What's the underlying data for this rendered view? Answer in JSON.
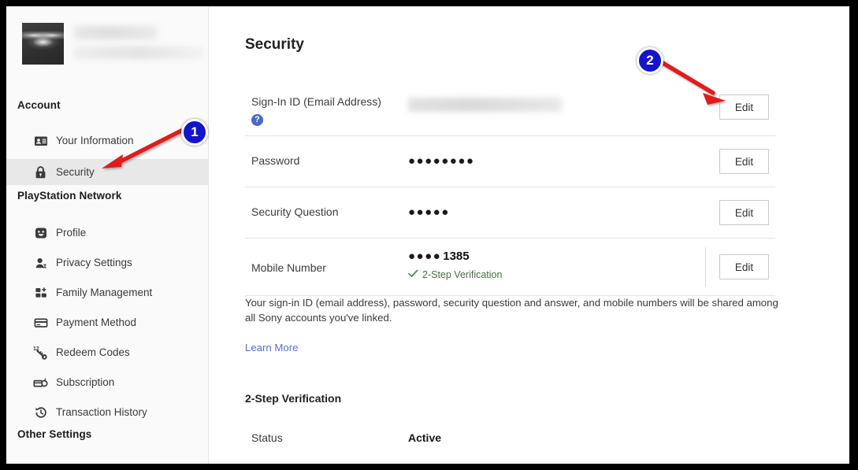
{
  "sidebar": {
    "profile": {
      "avatar_icon": "moth-avatar-image",
      "name_redacted": true,
      "email_redacted": true
    },
    "groups": [
      {
        "title": "Account"
      },
      {
        "title": "PlayStation Network"
      },
      {
        "title": "Other Settings"
      }
    ],
    "account_items": [
      {
        "label": "Your Information",
        "icon": "id-card-icon",
        "active": false
      },
      {
        "label": "Security",
        "icon": "lock-icon",
        "active": true
      }
    ],
    "psn_items": [
      {
        "label": "Profile",
        "icon": "smiley-face-icon"
      },
      {
        "label": "Privacy Settings",
        "icon": "privacy-person-icon"
      },
      {
        "label": "Family Management",
        "icon": "family-group-icon"
      },
      {
        "label": "Payment Method",
        "icon": "credit-card-icon"
      },
      {
        "label": "Redeem Codes",
        "icon": "redeem-key-icon"
      },
      {
        "label": "Subscription",
        "icon": "subscription-icon"
      },
      {
        "label": "Transaction History",
        "icon": "history-clock-icon"
      }
    ]
  },
  "main": {
    "title": "Security",
    "rows": [
      {
        "label": "Sign-In ID (Email Address)",
        "value": "",
        "value_redacted": true,
        "help_icon": "question-mark-icon",
        "button": "Edit"
      },
      {
        "label": "Password",
        "value": "●●●●●●●●",
        "button": "Edit"
      },
      {
        "label": "Security Question",
        "value": "●●●●●",
        "button": "Edit"
      },
      {
        "label": "Mobile Number",
        "value_mask": "●●●●",
        "value_digits": "1385",
        "sub_label": "2-Step Verification",
        "sub_icon": "green-check-icon",
        "button": "Edit"
      }
    ],
    "shared_note": "Your sign-in ID (email address), password, security question and answer, and mobile numbers will be shared among all Sony accounts you've linked.",
    "learn_more": "Learn More",
    "two_step": {
      "heading": "2-Step Verification",
      "status_label": "Status",
      "status_value": "Active"
    }
  },
  "annotations": {
    "markers": [
      {
        "number": "1",
        "points_to": "sidebar-item-security"
      },
      {
        "number": "2",
        "points_to": "edit-signin-id-button"
      }
    ],
    "arrow_color": "#e01b1b",
    "marker_color": "#1414cd"
  }
}
